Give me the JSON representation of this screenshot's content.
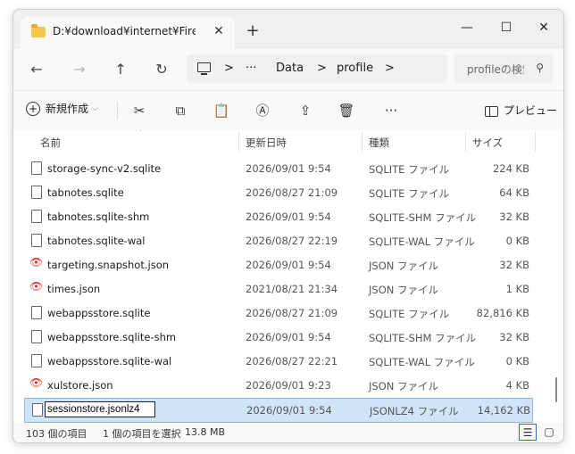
{
  "window": {
    "tab_title": "D:¥download¥internet¥Firefox",
    "tab_close": "✕",
    "new_tab": "+",
    "minimize": "—",
    "maximize": "☐",
    "close": "✕"
  },
  "nav": {
    "back": "←",
    "forward": "→",
    "up": "↑",
    "refresh": "↻",
    "sep1": ">",
    "ellipsis": "···",
    "crumb1": "Data",
    "sep2": ">",
    "crumb2": "profile",
    "sep3": ">",
    "search_placeholder": "profileの検索",
    "search_icon": "⚲"
  },
  "toolbar": {
    "new_label": "新規作成",
    "new_chevron": "⌵",
    "more": "···",
    "preview_label": "プレビュー"
  },
  "columns": {
    "name": "名前",
    "modified": "更新日時",
    "type": "種類",
    "size": "サイズ",
    "sort_indicator": "^"
  },
  "files": [
    {
      "name": "storage-sync-v2.sqlite",
      "modified": "2026/09/01 9:54",
      "type": "SQLITE ファイル",
      "size": "224 KB",
      "icon": "file-icon"
    },
    {
      "name": "tabnotes.sqlite",
      "modified": "2026/08/27 21:09",
      "type": "SQLITE ファイル",
      "size": "64 KB",
      "icon": "file-icon"
    },
    {
      "name": "tabnotes.sqlite-shm",
      "modified": "2026/09/01 9:54",
      "type": "SQLITE-SHM ファイル",
      "size": "32 KB",
      "icon": "file-icon"
    },
    {
      "name": "tabnotes.sqlite-wal",
      "modified": "2026/08/27 22:19",
      "type": "SQLITE-WAL ファイル",
      "size": "0 KB",
      "icon": "file-icon"
    },
    {
      "name": "targeting.snapshot.json",
      "modified": "2026/09/01 9:54",
      "type": "JSON ファイル",
      "size": "32 KB",
      "icon": "eye-icon"
    },
    {
      "name": "times.json",
      "modified": "2021/08/21 21:34",
      "type": "JSON ファイル",
      "size": "1 KB",
      "icon": "eye-icon"
    },
    {
      "name": "webappsstore.sqlite",
      "modified": "2026/08/27 21:09",
      "type": "SQLITE ファイル",
      "size": "82,816 KB",
      "icon": "file-icon"
    },
    {
      "name": "webappsstore.sqlite-shm",
      "modified": "2026/09/01 9:54",
      "type": "SQLITE-SHM ファイル",
      "size": "32 KB",
      "icon": "file-icon"
    },
    {
      "name": "webappsstore.sqlite-wal",
      "modified": "2026/08/27 22:21",
      "type": "SQLITE-WAL ファイル",
      "size": "0 KB",
      "icon": "file-icon"
    },
    {
      "name": "xulstore.json",
      "modified": "2026/09/01 9:23",
      "type": "JSON ファイル",
      "size": "4 KB",
      "icon": "eye-icon"
    }
  ],
  "selected_file": {
    "name": "sessionstore.jsonlz4",
    "modified": "2026/09/01 9:54",
    "type": "JSONLZ4 ファイル",
    "size": "14,162 KB"
  },
  "status": {
    "item_count": "103 個の項目",
    "selection": "1 個の項目を選択",
    "selection_size": "13.8 MB"
  },
  "colors": {
    "selection_bg": "#cfe4f8",
    "selection_border": "#8ab9e6",
    "eye_icon": "#d9312a",
    "folder": "#f2c94c"
  }
}
